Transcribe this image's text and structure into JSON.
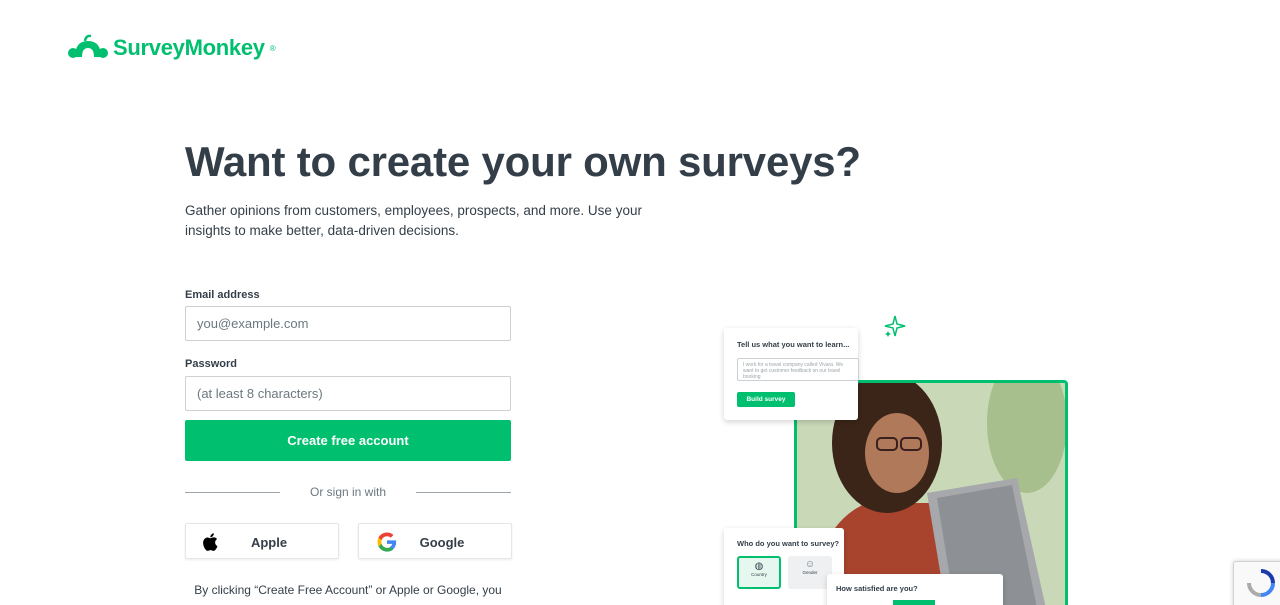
{
  "brand": {
    "name": "SurveyMonkey",
    "registered": "®",
    "color": "#00bf6f"
  },
  "hero": {
    "title": "Want to create your own surveys?",
    "subtitle": "Gather opinions from customers, employees, prospects, and more. Use your insights to make better, data-driven decisions."
  },
  "form": {
    "email_label": "Email address",
    "email_placeholder": "you@example.com",
    "email_value": "",
    "password_label": "Password",
    "password_placeholder": "(at least 8 characters)",
    "password_value": "",
    "submit_label": "Create free account",
    "divider_text": "Or sign in with",
    "apple_label": "Apple",
    "google_label": "Google",
    "legal_text": "By clicking “Create Free Account” or Apple or Google, you"
  },
  "illustration": {
    "learn_card": {
      "title": "Tell us what you want to learn...",
      "input_text": "I work for a travel company called Vivara. We want to get customer feedback on our travel booking",
      "button_label": "Build survey"
    },
    "who_card": {
      "title": "Who do you want to survey?",
      "options": [
        "Country",
        "Gender"
      ]
    },
    "satisfied_card": {
      "title": "How satisfied are you?"
    }
  },
  "colors": {
    "accent": "#00bf6f",
    "text": "#333e48",
    "muted": "#6b787f"
  }
}
